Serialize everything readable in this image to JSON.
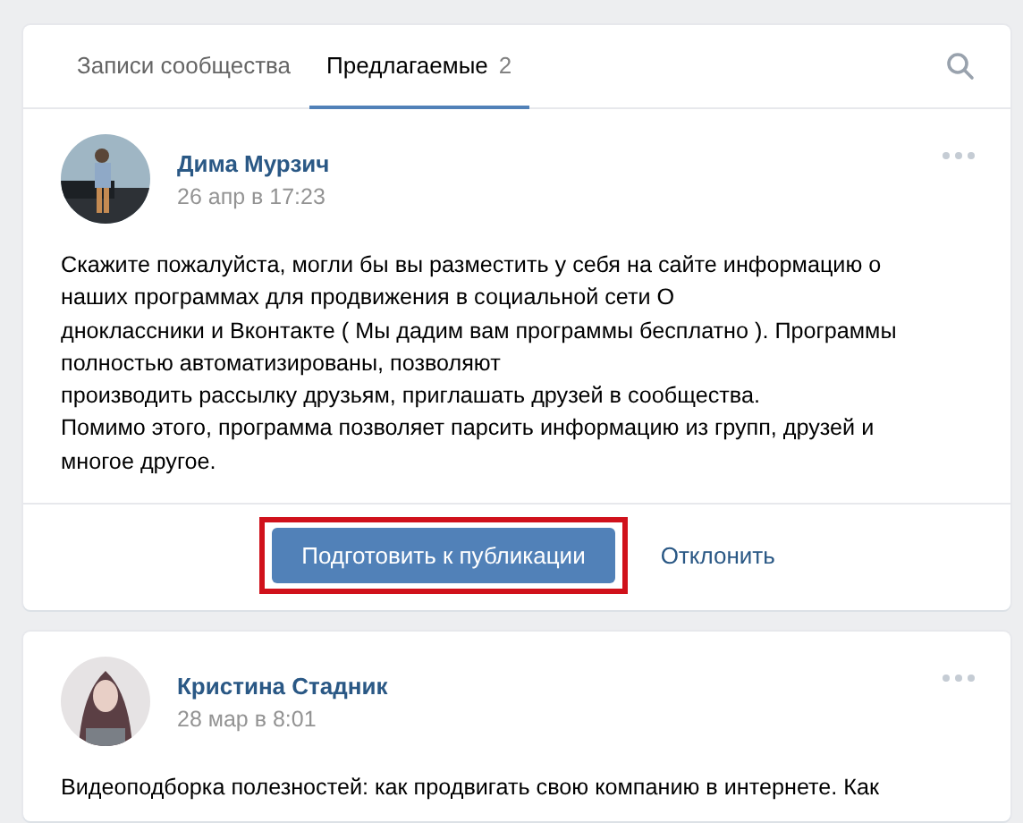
{
  "tabs": [
    {
      "label": "Записи сообщества",
      "selected": false
    },
    {
      "label": "Предлагаемые",
      "count": "2",
      "selected": true
    }
  ],
  "posts": [
    {
      "author": "Дима Мурзич",
      "date": "26 апр в 17:23",
      "text": "Скажите пожалуйста, могли бы вы разместить у себя на сайте информацию о\nнаших программах для продвижения в социальной сети О\nдноклассники и Вконтакте ( Мы дадим вам программы бесплатно ). Программы\nполностью автоматизированы, позволяют\nпроизводить рассылку друзьям, приглашать друзей в сообщества.\nПомимо этого, программа позволяет парсить информацию из групп, друзей и\nмногое другое.",
      "actions": {
        "publish": {
          "label": "Подготовить к публикации",
          "highlighted": true
        },
        "reject": "Отклонить"
      }
    },
    {
      "author": "Кристина Стадник",
      "date": "28 мар в 8:01",
      "text": "Видеоподборка полезностей: как продвигать свою компанию в интернете. Как"
    }
  ]
}
